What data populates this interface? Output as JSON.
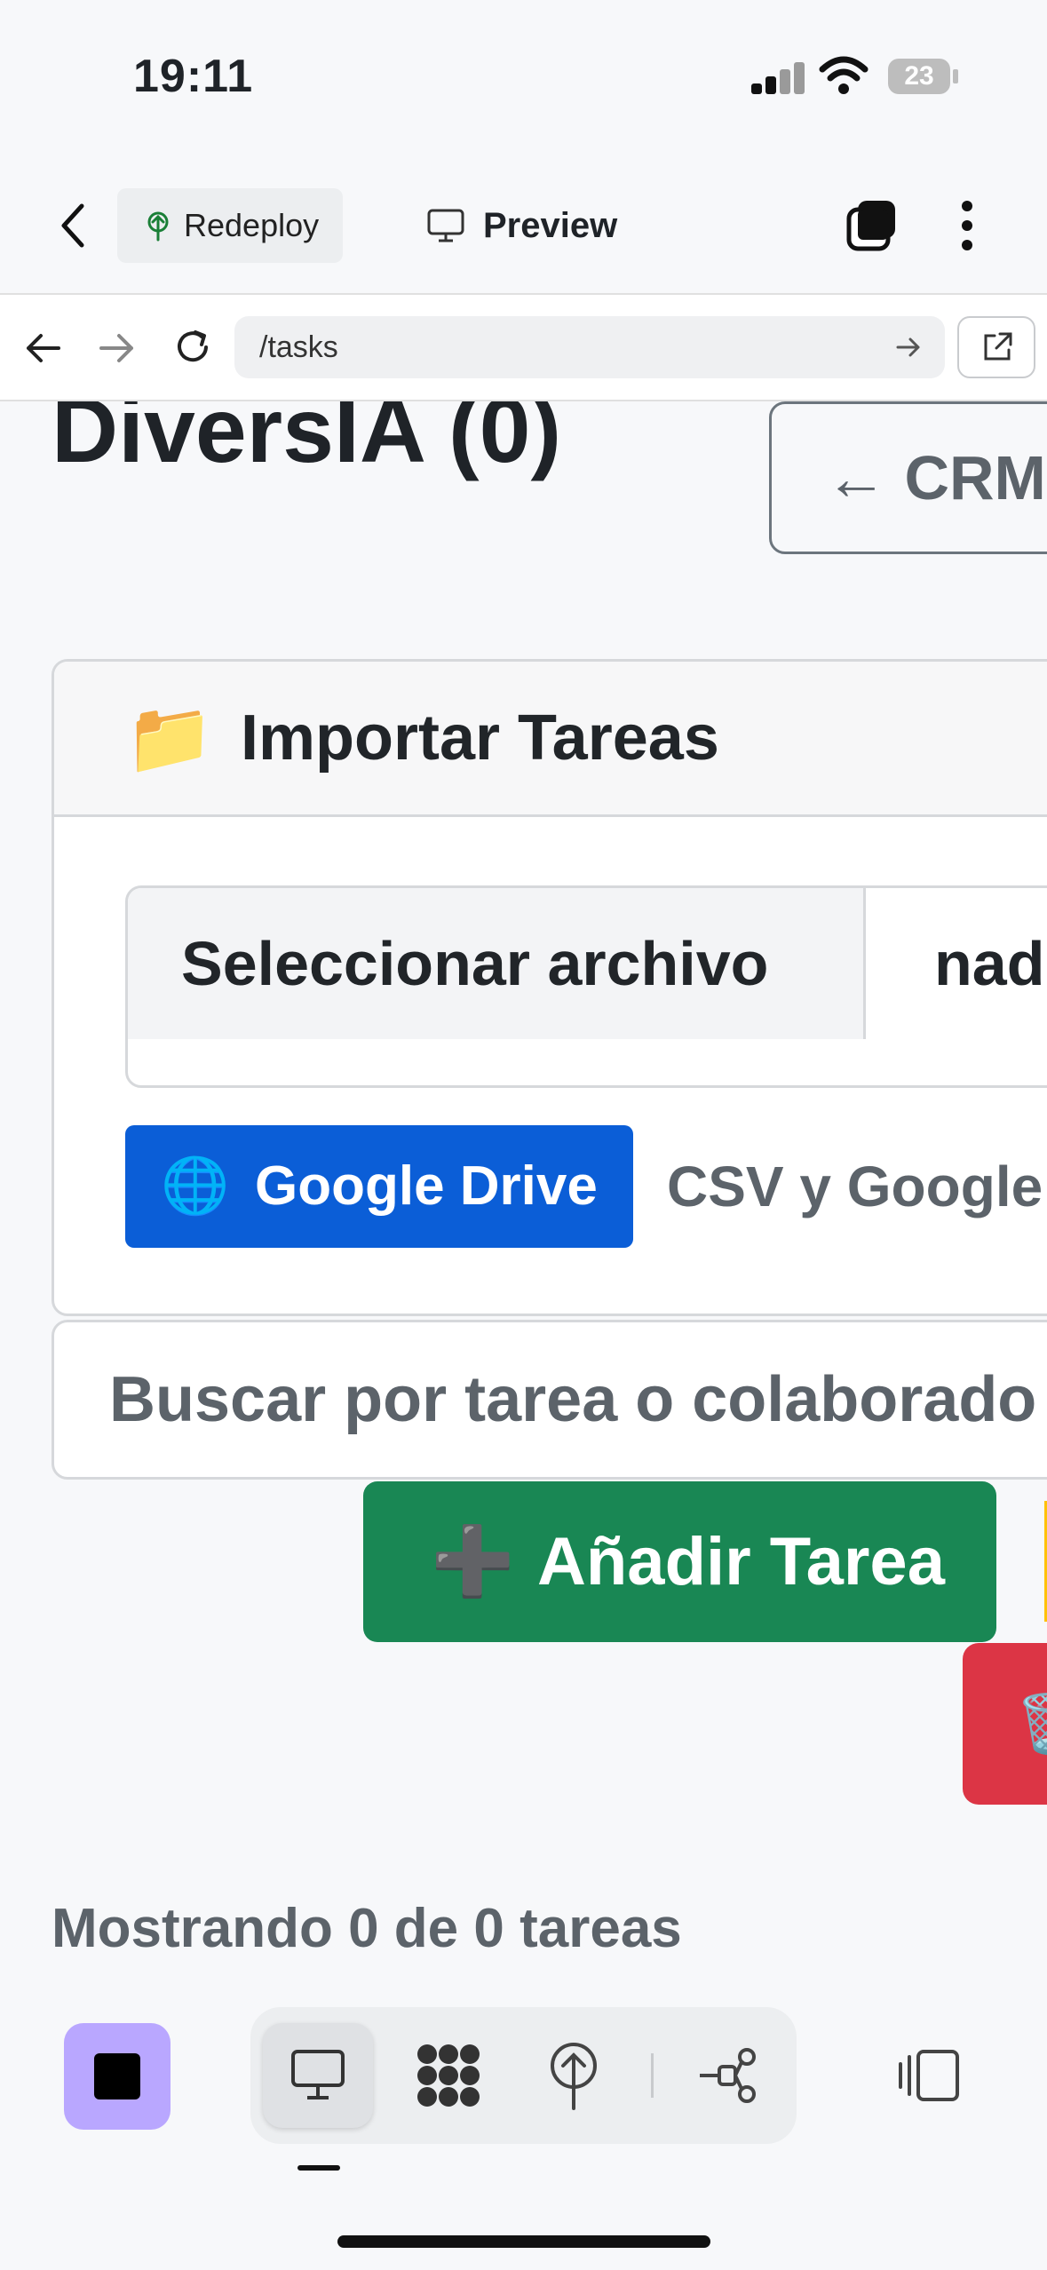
{
  "status_bar": {
    "time": "19:11",
    "battery": "23"
  },
  "header": {
    "redeploy_label": "Redeploy",
    "preview_label": "Preview"
  },
  "browser": {
    "url": "/tasks"
  },
  "page": {
    "title": "DiversIA (0)",
    "crm_button_label": "← CRM",
    "import_card": {
      "icon": "📁",
      "title": "Importar Tareas",
      "file_button_label": "Seleccionar archivo",
      "file_status": "nad",
      "gdrive_icon": "🌐",
      "gdrive_button_label": "Google Drive",
      "hint": "CSV y Google"
    },
    "search": {
      "placeholder": "Buscar por tarea o colaborado"
    },
    "add_task": {
      "icon": "➕",
      "label": "Añadir Tarea"
    },
    "delete_icon": "🗑️",
    "count_text": "Mostrando 0 de 0 tareas"
  },
  "colors": {
    "primary": "#0b5ed7",
    "success": "#198754",
    "danger": "#dc3545",
    "accent_stop": "#b9a7ff"
  }
}
